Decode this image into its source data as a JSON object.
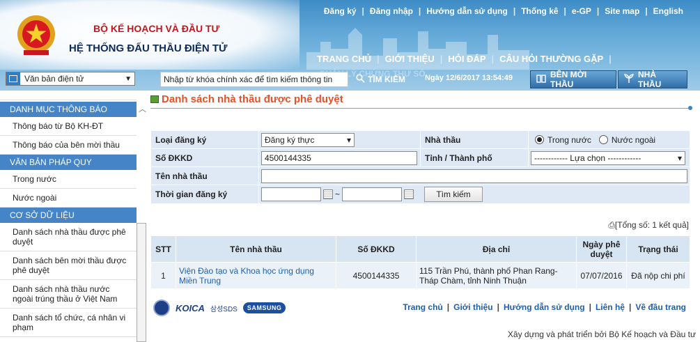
{
  "header": {
    "org_line1": "BỘ KẾ HOẠCH VÀ ĐẦU TƯ",
    "org_line2": "HỆ THỐNG ĐẤU THẦU ĐIỆN TỬ",
    "top_links": [
      "Đăng ký",
      "Đăng nhập",
      "Hướng dẫn sử dụng",
      "Thống kê",
      "e-GP",
      "Site map",
      "English"
    ],
    "main_nav": [
      "TRANG CHỦ",
      "GIỚI THIỆU",
      "HỎI ĐÁP",
      "CÂU HỎI THƯỜNG GẶP"
    ],
    "main_nav_row2": "QUẢN LÝ CHỨNG THƯ SỐ"
  },
  "toolbar": {
    "doc_select": "Văn bản điện tử",
    "search_input": "Nhập từ khóa chính xác để tìm kiếm thông tin",
    "search_button": "TÌM KIẾM",
    "datetime": "Ngày 12/6/2017 13:54:49",
    "btn_ben_moi_thau": "BÊN MỜI THẦU",
    "btn_nha_thau": "NHÀ THẦU"
  },
  "sidebar": {
    "sec1_title": "DANH MỤC THÔNG BÁO",
    "sec1_items": [
      "Thông báo từ Bộ KH-ĐT",
      "Thông báo của bên mời thầu"
    ],
    "sec2_title": "VĂN BẢN PHÁP QUY",
    "sec2_items": [
      "Trong nước",
      "Nước ngoài"
    ],
    "sec3_title": "CƠ SỞ DỮ LIỆU",
    "sec3_items": [
      "Danh sách nhà thầu được phê duyệt",
      "Danh sách bên mời thầu được phê duyệt",
      "Danh sách nhà thầu nước ngoài trúng thầu ở Việt Nam",
      "Danh sách tổ chức, cá nhân vi phạm"
    ]
  },
  "page": {
    "title": "Danh sách nhà thầu được phê duyệt"
  },
  "form": {
    "loai_dang_ky_label": "Loại đăng ký",
    "loai_dang_ky_value": "Đăng ký thực",
    "nha_thau_label": "Nhà thầu",
    "radio_trong_nuoc": "Trong nước",
    "radio_nuoc_ngoai": "Nước ngoài",
    "so_dkkd_label": "Số ĐKKD",
    "so_dkkd_value": "4500144335",
    "tinh_label": "Tỉnh / Thành phố",
    "tinh_value": "------------ Lựa chọn ------------",
    "ten_nha_thau_label": "Tên nhà thầu",
    "thoi_gian_label": "Thời gian đăng ký",
    "search_btn": "Tìm kiếm"
  },
  "results": {
    "total": "[Tổng số: 1 kết quả]",
    "headers": [
      "STT",
      "Tên nhà thầu",
      "Số ĐKKD",
      "Địa chỉ",
      "Ngày phê duyệt",
      "Trạng thái"
    ],
    "row": {
      "stt": "1",
      "name": "Viện Đào tạo và Khoa học ứng dụng Miền Trung",
      "dkkd": "4500144335",
      "address": "115 Trần Phú, thành phố Phan Rang-Tháp Chàm, tỉnh Ninh Thuận",
      "date": "07/07/2016",
      "status": "Đã nộp chi phí"
    }
  },
  "footer": {
    "links": [
      "Trang chủ",
      "Giới thiệu",
      "Hướng dẫn sử dụng",
      "Liên hệ",
      "Về đầu trang"
    ],
    "credit": "Xây dựng và phát triển bởi Bộ Kế hoạch và Đầu tư",
    "logo_koica": "KOICA",
    "logo_sds": "삼성SDS",
    "logo_samsung": "SAMSUNG"
  }
}
